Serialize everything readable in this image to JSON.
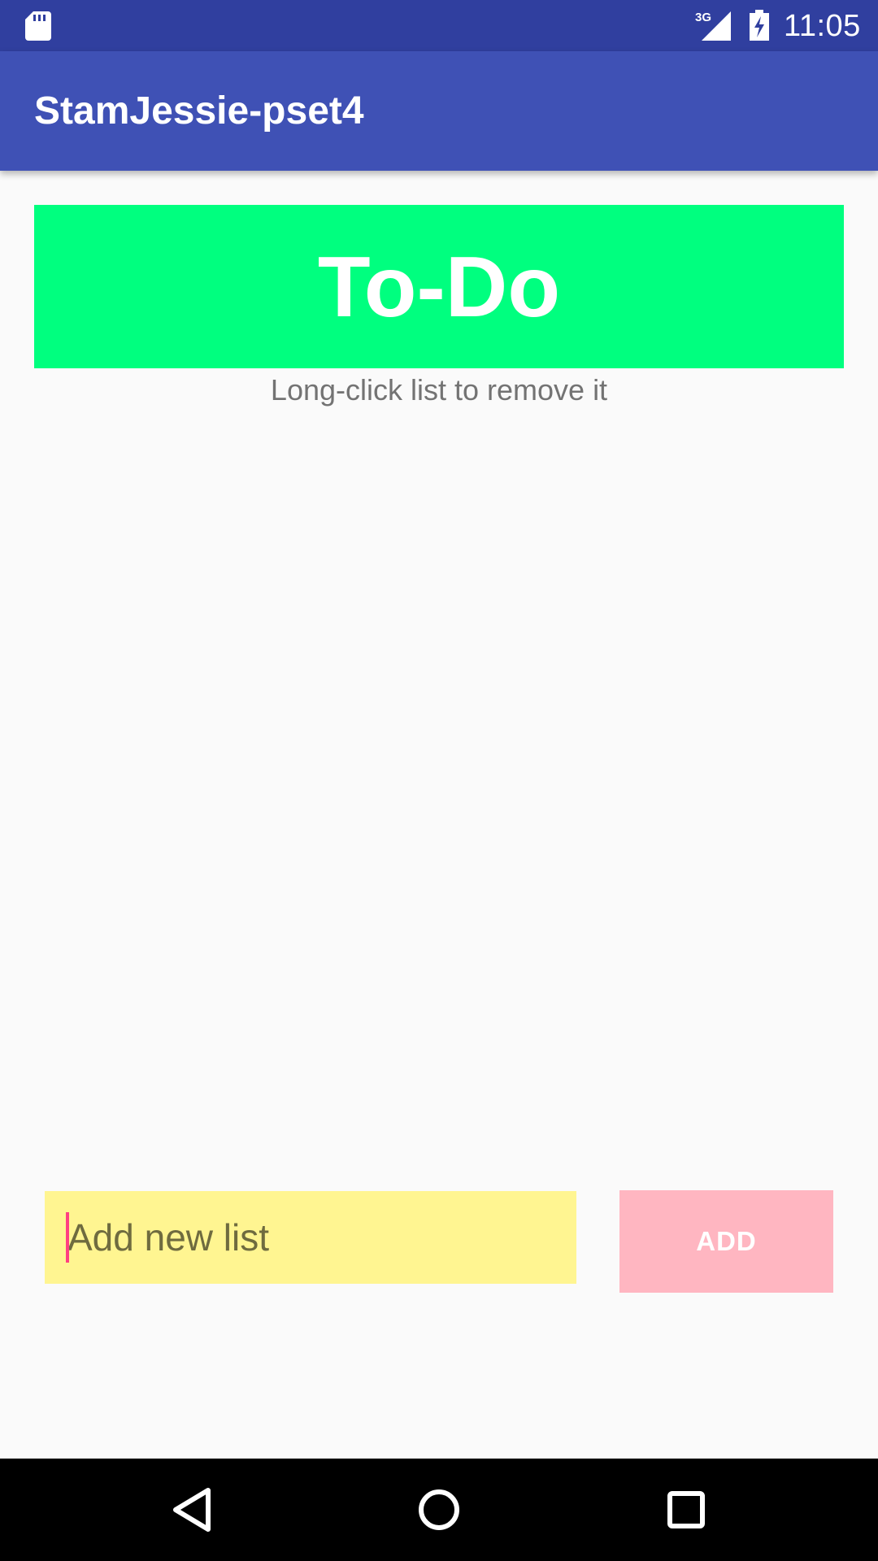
{
  "status_bar": {
    "time": "11:05",
    "network_label": "3G",
    "icons": [
      "sd-card-icon",
      "signal-icon",
      "battery-charging-icon"
    ]
  },
  "app_bar": {
    "title": "StamJessie-pset4"
  },
  "header": {
    "title": "To-Do",
    "hint": "Long-click list to remove it"
  },
  "lists": [],
  "new_list": {
    "placeholder": "Add new list",
    "value": ""
  },
  "add_button": {
    "label": "ADD"
  },
  "nav_bar": {
    "icons": [
      "back-icon",
      "home-icon",
      "recents-icon"
    ]
  },
  "colors": {
    "status_bar": "#303f9f",
    "app_bar": "#3f51b5",
    "header_bg": "#00ff7f",
    "input_bg": "#fff591",
    "add_button_bg": "#ffb6c1",
    "cursor": "#ff4081"
  }
}
